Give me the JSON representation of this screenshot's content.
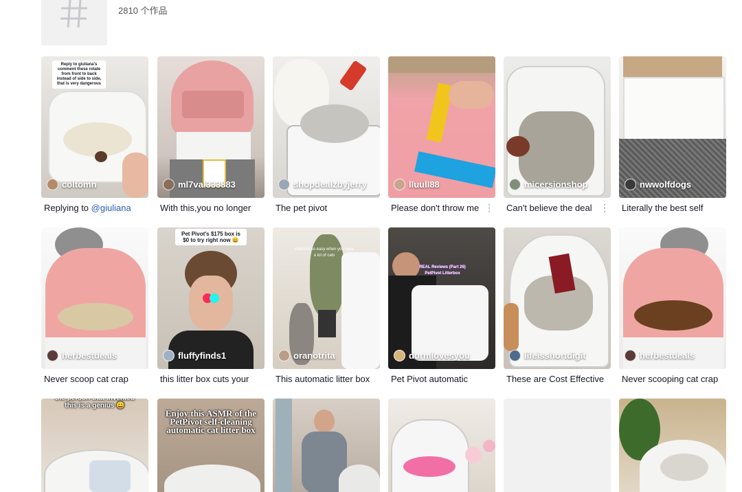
{
  "header": {
    "post_count": "2810 个作品"
  },
  "videos": [
    {
      "handle": "coltomn",
      "caption_prefix": "Replying to ",
      "mention": "@giuliana",
      "caption": "",
      "avatar_color": "#b58a6a"
    },
    {
      "handle": "ml7val333883",
      "caption": "With this,you no longer",
      "avatar_color": "#8a6d5a"
    },
    {
      "handle": "shopdealzbyjerry",
      "caption": "The pet pivot",
      "avatar_color": "#9aa7b4"
    },
    {
      "handle": "lluull88",
      "caption": "Please don't throw me",
      "avatar_color": "#c8a58c",
      "has_more": true
    },
    {
      "handle": "micersionshop",
      "caption": "Can't believe the deal",
      "avatar_color": "#7f8f7a",
      "has_more": true
    },
    {
      "handle": "nwwolfdogs",
      "caption": "Literally the best self",
      "avatar_color": "#3a3a3a"
    },
    {
      "handle": "herbestdeals",
      "caption": "Never scoop cat crap",
      "avatar_color": "#5b3a3a"
    },
    {
      "handle": "fluffyfinds1",
      "caption": "this litter box cuts your",
      "avatar_color": "#9fb0c3"
    },
    {
      "handle": "oranotrita",
      "caption": "This automatic litter box",
      "avatar_color": "#b99e86"
    },
    {
      "handle": "dormlovesyou",
      "caption": "Pet Pivot automatic",
      "avatar_color": "#d6b37a"
    },
    {
      "handle": "lifeisshortdigit",
      "caption": "These are Cost Effective",
      "avatar_color": "#4d6b8a"
    },
    {
      "handle": "herbestdeals",
      "caption": "Never scooping cat crap",
      "avatar_color": "#5b3a3a"
    },
    {
      "handle": "",
      "caption": ""
    },
    {
      "handle": "",
      "caption": ""
    },
    {
      "handle": "",
      "caption": ""
    },
    {
      "handle": "",
      "caption": ""
    },
    {
      "handle": "",
      "caption": ""
    },
    {
      "handle": "",
      "caption": ""
    }
  ],
  "overlays": {
    "v1_note": "Reply to giuliana's comment these rotate from front to back instead of side to side, that is very dangerous",
    "v8_note": "Pet Pivot's $175 box is $0 to try right now 😀",
    "v9_note": "makes it so easy when you have a lot of cats",
    "v10_note": "REAL Reviews (Part 26) PetPivot Litterbox",
    "v13_note": "the person that invented this is a genius 😀",
    "v14_note": "Enjoy this ASMR of the PetPivot self-cleaning automatic cat litter box"
  },
  "colors": {
    "mention": "#2b5db9",
    "caption": "#161823",
    "placeholder": "#f1f1f2"
  }
}
